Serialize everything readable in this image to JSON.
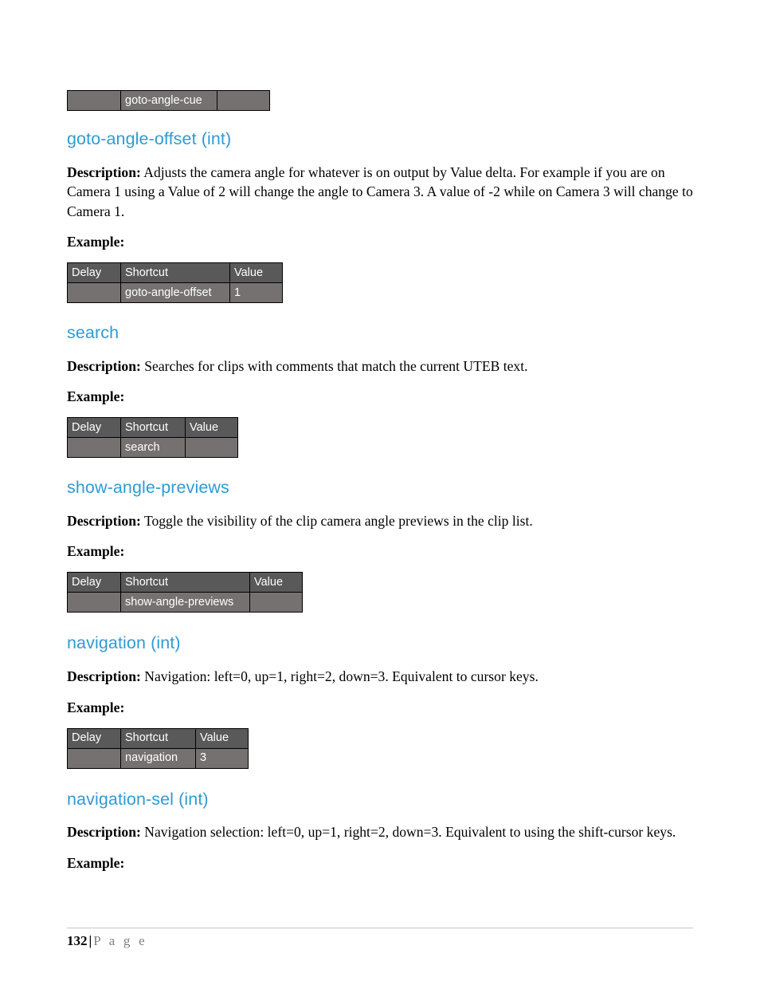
{
  "document": {
    "page_number": "132",
    "footer_separator": "|",
    "footer_word": "P a g e",
    "heading_color": "#2e9bd6",
    "table_header_color": "#595959",
    "table_row_color": "#767171"
  },
  "continued_table": {
    "name": "goto-angle-cue-table-continued",
    "delay": "",
    "shortcut": "goto-angle-cue",
    "value": ""
  },
  "labels": {
    "description": "Description:",
    "example": "Example:",
    "col_delay": "Delay",
    "col_shortcut": "Shortcut",
    "col_value": "Value"
  },
  "sections": [
    {
      "id": "goto-angle-offset",
      "heading": "goto-angle-offset (int)",
      "description": "Adjusts the camera angle for whatever is on output by Value delta. For example if you are on Camera 1 using a Value of 2 will change the angle to Camera 3. A value of -2 while on Camera 3 will change to Camera 1.",
      "justified": false,
      "table": {
        "delay": "",
        "shortcut": "goto-angle-offset",
        "value": "1"
      }
    },
    {
      "id": "search",
      "heading": "search",
      "description": "Searches for clips with comments that match the current UTEB text.",
      "justified": false,
      "table": {
        "delay": "",
        "shortcut": "search",
        "value": ""
      }
    },
    {
      "id": "show-angle-previews",
      "heading": "show-angle-previews",
      "description": "Toggle the visibility of the clip camera angle previews in the clip list.",
      "justified": false,
      "table": {
        "delay": "",
        "shortcut": "show-angle-previews",
        "value": ""
      }
    },
    {
      "id": "navigation",
      "heading": "navigation (int)",
      "description": "Navigation: left=0, up=1, right=2, down=3.  Equivalent to cursor keys.",
      "justified": false,
      "table": {
        "delay": "",
        "shortcut": "navigation",
        "value": "3"
      }
    },
    {
      "id": "navigation-sel",
      "heading": "navigation-sel (int)",
      "description": "Navigation selection: left=0, up=1, right=2, down=3.  Equivalent to using the shift-cursor keys.",
      "justified": true,
      "table": null
    }
  ]
}
